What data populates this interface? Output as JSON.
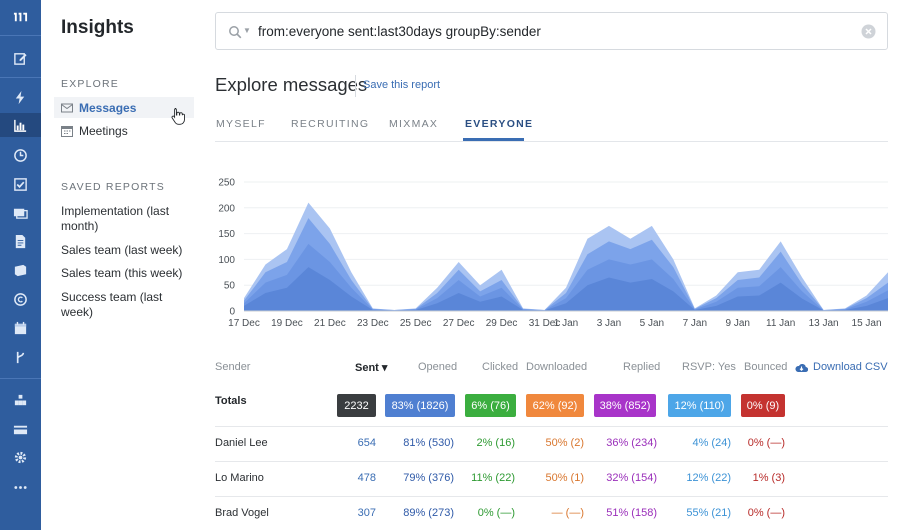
{
  "app": {
    "title": "Insights"
  },
  "rail": {
    "icons": [
      "mixmax-logo-icon",
      "compose-icon",
      "lightning-icon",
      "bar-chart-icon",
      "clock-icon",
      "checklist-icon",
      "inbox-stack-icon",
      "document-icon",
      "book-icon",
      "copyright-icon",
      "calendar-icon",
      "branch-icon",
      "team-icon",
      "card-icon",
      "gear-icon",
      "more-icon"
    ]
  },
  "nav": {
    "explore_label": "EXPLORE",
    "items": [
      {
        "label": "Messages",
        "icon": "envelope-icon"
      },
      {
        "label": "Meetings",
        "icon": "calendar-icon"
      }
    ],
    "saved_label": "SAVED REPORTS",
    "saved": [
      "Implementation (last month)",
      "Sales team (last week)",
      "Sales team (this week)",
      "Success team (last week)"
    ]
  },
  "search": {
    "query": "from:everyone sent:last30days groupBy:sender"
  },
  "header": {
    "title": "Explore messages",
    "save_link": "Save this report"
  },
  "tabs": [
    {
      "label": "MYSELF"
    },
    {
      "label": "RECRUITING"
    },
    {
      "label": "MIXMAX"
    },
    {
      "label": "EVERYONE"
    }
  ],
  "active_tab": "EVERYONE",
  "chart_data": {
    "type": "area",
    "x": [
      "17 Dec",
      "18 Dec",
      "19 Dec",
      "20 Dec",
      "21 Dec",
      "22 Dec",
      "23 Dec",
      "24 Dec",
      "25 Dec",
      "26 Dec",
      "27 Dec",
      "28 Dec",
      "29 Dec",
      "30 Dec",
      "31 Dec",
      "1 Jan",
      "2 Jan",
      "3 Jan",
      "4 Jan",
      "5 Jan",
      "6 Jan",
      "7 Jan",
      "8 Jan",
      "9 Jan",
      "10 Jan",
      "11 Jan",
      "12 Jan",
      "13 Jan",
      "14 Jan",
      "15 Jan",
      "16 Jan"
    ],
    "x_tick_labels": [
      "17 Dec",
      "19 Dec",
      "21 Dec",
      "23 Dec",
      "25 Dec",
      "27 Dec",
      "29 Dec",
      "31 Dec",
      "1 Jan",
      "3 Jan",
      "5 Jan",
      "7 Jan",
      "9 Jan",
      "11 Jan",
      "13 Jan",
      "15 Jan"
    ],
    "ylim": [
      0,
      250
    ],
    "yticks": [
      0,
      50,
      100,
      150,
      200,
      250
    ],
    "series": [
      {
        "values": [
          25,
          90,
          120,
          210,
          160,
          75,
          5,
          2,
          5,
          45,
          95,
          50,
          80,
          5,
          2,
          45,
          140,
          165,
          140,
          165,
          100,
          5,
          30,
          75,
          80,
          135,
          65,
          2,
          5,
          30,
          75
        ],
        "color": "#aac4f2"
      },
      {
        "values": [
          20,
          75,
          95,
          180,
          130,
          60,
          4,
          2,
          4,
          35,
          80,
          38,
          60,
          4,
          2,
          35,
          110,
          135,
          120,
          138,
          85,
          4,
          25,
          60,
          65,
          115,
          52,
          2,
          4,
          25,
          55
        ],
        "color": "#7ca3ea"
      },
      {
        "values": [
          15,
          55,
          70,
          130,
          95,
          45,
          3,
          1,
          3,
          25,
          60,
          28,
          45,
          3,
          1,
          25,
          80,
          100,
          90,
          100,
          62,
          3,
          18,
          45,
          48,
          85,
          38,
          1,
          3,
          18,
          40
        ],
        "color": "#6b95e3"
      },
      {
        "values": [
          10,
          35,
          45,
          85,
          60,
          28,
          2,
          1,
          2,
          15,
          35,
          18,
          28,
          2,
          1,
          15,
          50,
          65,
          55,
          62,
          38,
          2,
          10,
          28,
          30,
          55,
          24,
          1,
          2,
          10,
          25
        ],
        "color": "#5a86d8"
      }
    ]
  },
  "table": {
    "sender_header": "Sender",
    "columns": [
      "Sent",
      "Opened",
      "Clicked",
      "Downloaded",
      "Replied",
      "RSVP: Yes",
      "Bounced"
    ],
    "sort_indicator": "▾",
    "download_label": "Download CSV",
    "totals_label": "Totals",
    "totals": [
      {
        "text": "2232",
        "color": "#3a3d40"
      },
      {
        "text": "83% (1826)",
        "color": "#4f7fd1"
      },
      {
        "text": "6% (76)",
        "color": "#3bae3f"
      },
      {
        "text": "62% (92)",
        "color": "#f0883d"
      },
      {
        "text": "38% (852)",
        "color": "#a834c9"
      },
      {
        "text": "12% (110)",
        "color": "#4da6e8"
      },
      {
        "text": "0% (9)",
        "color": "#c43330"
      }
    ],
    "rows": [
      {
        "name": "Daniel Lee",
        "cells": [
          "654",
          "81% (530)",
          "2% (16)",
          "50% (2)",
          "36% (234)",
          "4% (24)",
          "0% (—)"
        ]
      },
      {
        "name": "Lo Marino",
        "cells": [
          "478",
          "79% (376)",
          "11% (22)",
          "50% (1)",
          "32% (154)",
          "12% (22)",
          "1% (3)"
        ]
      },
      {
        "name": "Brad Vogel",
        "cells": [
          "307",
          "89% (273)",
          "0% (—)",
          "— (—)",
          "51% (158)",
          "55% (21)",
          "0% (—)"
        ]
      }
    ],
    "cell_colors": [
      "#3a6db3",
      "#2f5aa8",
      "#2e9a32",
      "#d9772f",
      "#9a2fba",
      "#3d93d6",
      "#b82c2a"
    ]
  }
}
